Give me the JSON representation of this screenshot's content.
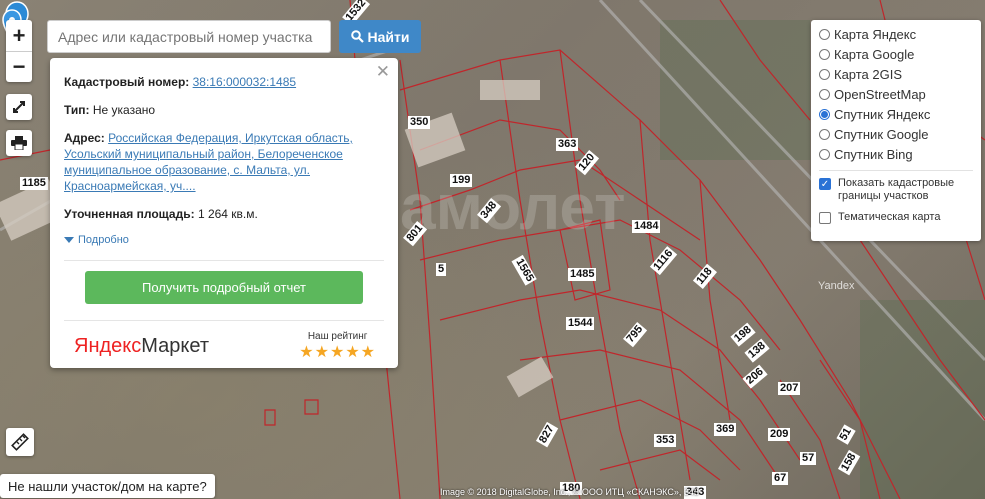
{
  "search": {
    "placeholder": "Адрес или кадастровый номер участка",
    "button_label": "Найти"
  },
  "zoom": {
    "in_label": "+",
    "out_label": "−"
  },
  "info": {
    "cadastral_label": "Кадастровый номер:",
    "cadastral_value": "38:16:000032:1485",
    "type_label": "Тип:",
    "type_value": "Не указано",
    "address_label": "Адрес:",
    "address_value": "Российская Федерация, Иркутская область, Усольский муниципальный район, Белореченское муниципальное образование, с. Мальта, ул. Красноармейская, уч....",
    "area_label": "Уточненная площадь:",
    "area_value": "1 264 кв.м.",
    "details_label": "Подробно",
    "report_button": "Получить подробный отчет",
    "market_logo_ya": "Яндекс",
    "market_logo_rest": "Маркет",
    "rating_label": "Наш рейтинг",
    "stars": "★★★★★"
  },
  "layers": {
    "map_types": [
      "Карта Яндекс",
      "Карта Google",
      "Карта 2GIS",
      "OpenStreetMap",
      "Спутник Яндекс",
      "Спутник Google",
      "Спутник Bing"
    ],
    "selected_index": 4,
    "options": [
      {
        "label": "Показать кадастровые границы участков",
        "checked": true
      },
      {
        "label": "Тематическая карта",
        "checked": false
      }
    ]
  },
  "not_found": "Не нашли участок/дом на карте?",
  "copyright": "Image © 2018 DigitalGlobe, Inc., © ООО ИТЦ «СКАНЭКС», 343",
  "watermark": "амолет",
  "map_attribution": "Yandex",
  "parcels": [
    "1532",
    "350",
    "363",
    "120",
    "199",
    "348",
    "1185",
    "801",
    "5",
    "1565",
    "1485",
    "1484",
    "1116",
    "118",
    "1544",
    "795",
    "198",
    "138",
    "206",
    "207",
    "827",
    "353",
    "369",
    "209",
    "57",
    "158",
    "180",
    "343",
    "67",
    "51"
  ],
  "colors": {
    "accent": "#3f88c8",
    "report": "#5cb85c",
    "boundary": "#c0262b"
  }
}
